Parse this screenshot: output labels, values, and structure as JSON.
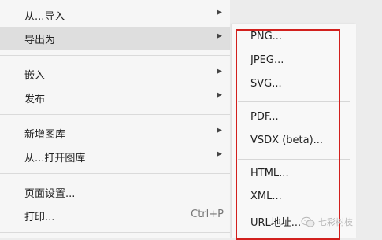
{
  "main_menu": {
    "items": [
      {
        "label": "从...导入",
        "has_submenu": true
      },
      {
        "label": "导出为",
        "has_submenu": true,
        "highlighted": true
      },
      {
        "label": "嵌入",
        "has_submenu": true
      },
      {
        "label": "发布",
        "has_submenu": true
      },
      {
        "label": "新增图库",
        "has_submenu": true
      },
      {
        "label": "从...打开图库",
        "has_submenu": true
      },
      {
        "label": "页面设置..."
      },
      {
        "label": "打印...",
        "shortcut": "Ctrl+P"
      }
    ]
  },
  "export_submenu": {
    "items": [
      "PNG...",
      "JPEG...",
      "SVG...",
      "PDF...",
      "VSDX (beta)...",
      "HTML...",
      "XML...",
      "URL地址..."
    ]
  },
  "arrow_glyph": "▶",
  "watermark": {
    "text": "七彩树枝",
    "icon": "wechat-icon"
  },
  "colors": {
    "highlight_box": "#d2201d",
    "menu_bg": "#f6f6f6",
    "hover_bg": "#dedede"
  }
}
